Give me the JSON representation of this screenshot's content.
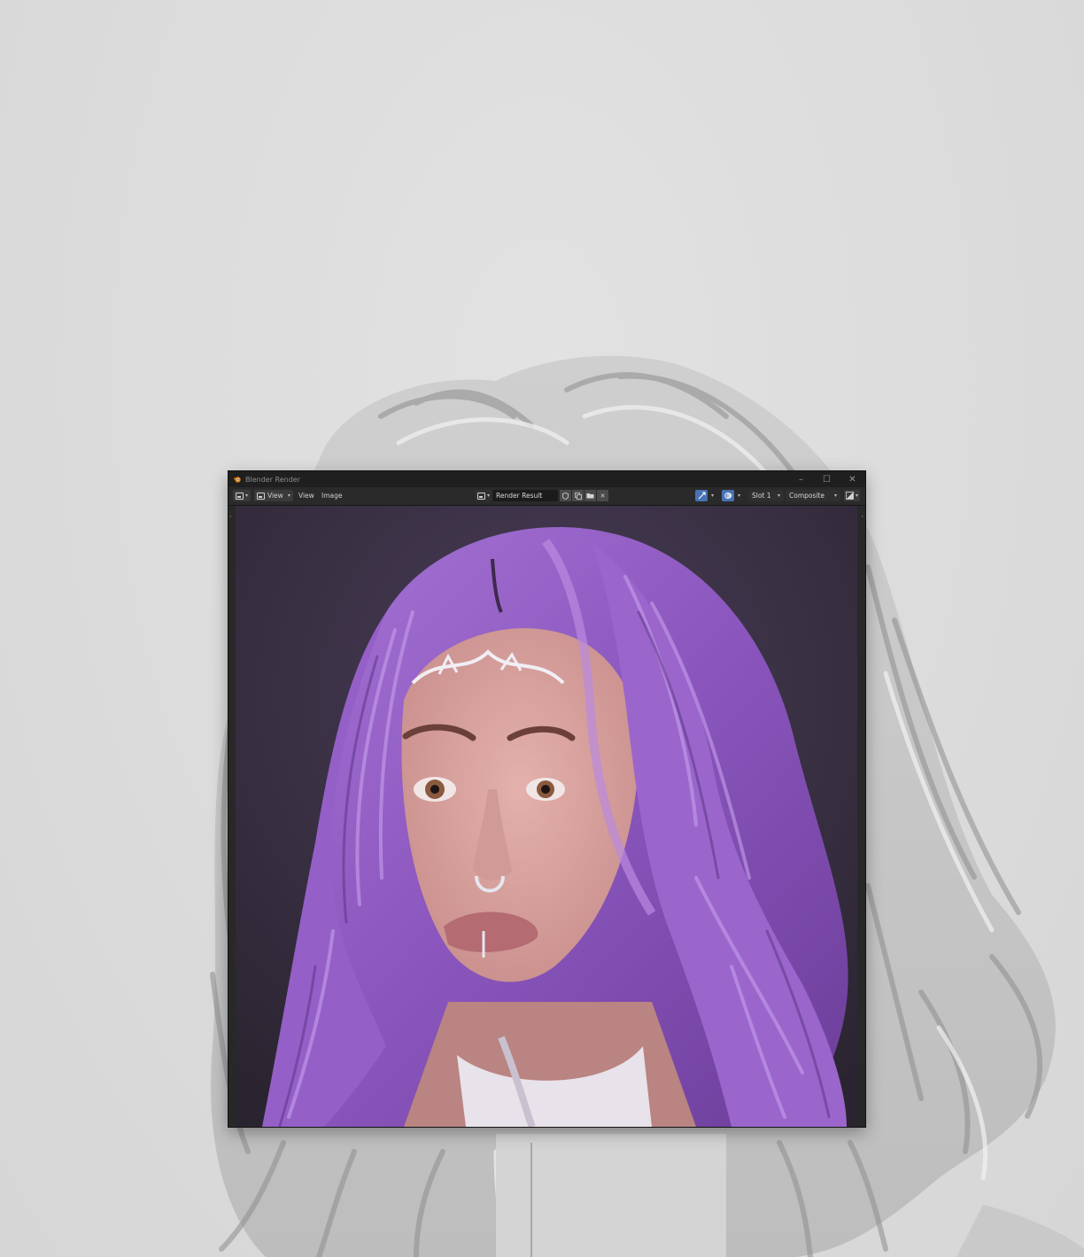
{
  "window": {
    "title": "Blender Render",
    "controls": {
      "minimize": "–",
      "maximize": "☐",
      "close": "✕"
    }
  },
  "header": {
    "menus": [
      {
        "label": "View",
        "has_dropdown": true
      },
      {
        "label": "View",
        "has_dropdown": false
      },
      {
        "label": "Image",
        "has_dropdown": false
      }
    ],
    "image_name": "Render Result",
    "slot": "Slot 1",
    "layer": "Composite"
  },
  "colors": {
    "accent_blue": "#4772b3",
    "hair_purple": "#9a63c9",
    "background": "#dcdcdc"
  },
  "icons": {
    "editor_type": "image-editor-icon",
    "image_browse": "image-browse-icon",
    "fake_user": "shield-icon",
    "duplicate": "duplicate-icon",
    "open": "folder-icon",
    "unlink": "close-icon",
    "gizmo": "gizmo-icon",
    "overlay": "overlay-icon",
    "display_channels": "display-channels-icon"
  }
}
